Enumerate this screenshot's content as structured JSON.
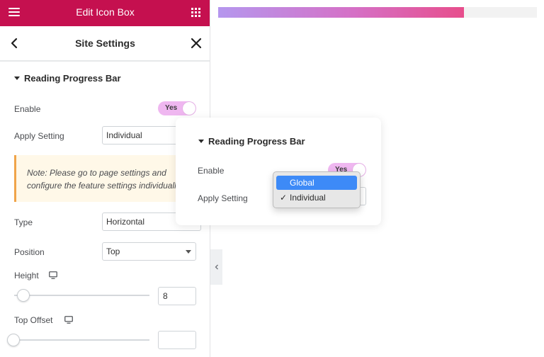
{
  "topbar": {
    "title": "Edit Icon Box",
    "color": "#c5104f"
  },
  "settings": {
    "title": "Site Settings"
  },
  "section": {
    "title": "Reading Progress Bar"
  },
  "fields": {
    "enable_label": "Enable",
    "enable_toggle": "Yes",
    "apply_label": "Apply Setting",
    "apply_value": "Individual",
    "note_line1": "Note: Please go to page settings and",
    "note_line2": "configure the feature settings individually.",
    "type_label": "Type",
    "type_value": "Horizontal",
    "position_label": "Position",
    "position_value": "Top",
    "height_label": "Height",
    "height_value": "8",
    "top_offset_label": "Top Offset",
    "top_offset_value": ""
  },
  "progress": {
    "fraction": 0.77,
    "gradient": [
      "#b597ee",
      "#d570c6",
      "#e74e8c"
    ]
  },
  "card": {
    "title": "Reading Progress Bar",
    "enable_label": "Enable",
    "enable_toggle": "Yes",
    "apply_label": "Apply Setting"
  },
  "dropdown": {
    "options": [
      {
        "label": "Global",
        "highlighted": true,
        "checked": false
      },
      {
        "label": "Individual",
        "highlighted": false,
        "checked": true
      }
    ],
    "check_glyph": "✓",
    "highlight_color": "#3d8af7"
  },
  "icons": {
    "menu": "hamburger-icon",
    "apps": "grid-icon",
    "back": "chevron-left-icon",
    "close": "close-icon",
    "responsive": "desktop-monitor-icon",
    "collapse": "chevron-left-icon"
  }
}
